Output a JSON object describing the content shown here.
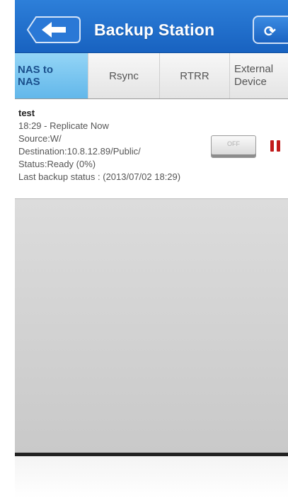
{
  "header": {
    "title": "Backup Station",
    "back_icon": "arrow-left-icon",
    "refresh_icon": "refresh-icon",
    "accent_color": "#1f6fd1"
  },
  "tabs": [
    {
      "label_line1": "NAS to",
      "label_line2": "NAS",
      "active": true
    },
    {
      "label": "Rsync",
      "active": false
    },
    {
      "label": "RTRR",
      "active": false
    },
    {
      "label_line1": "External",
      "label_line2": "Device",
      "active": false
    }
  ],
  "job": {
    "name": "test",
    "schedule": "18:29 - Replicate Now",
    "source": "Source:W/",
    "destination": "Destination:10.8.12.89/Public/",
    "status": "Status:Ready (0%)",
    "last_backup": "Last backup status : (2013/07/02  18:29)",
    "toggle_label": "OFF",
    "pause_icon": "pause-icon"
  }
}
